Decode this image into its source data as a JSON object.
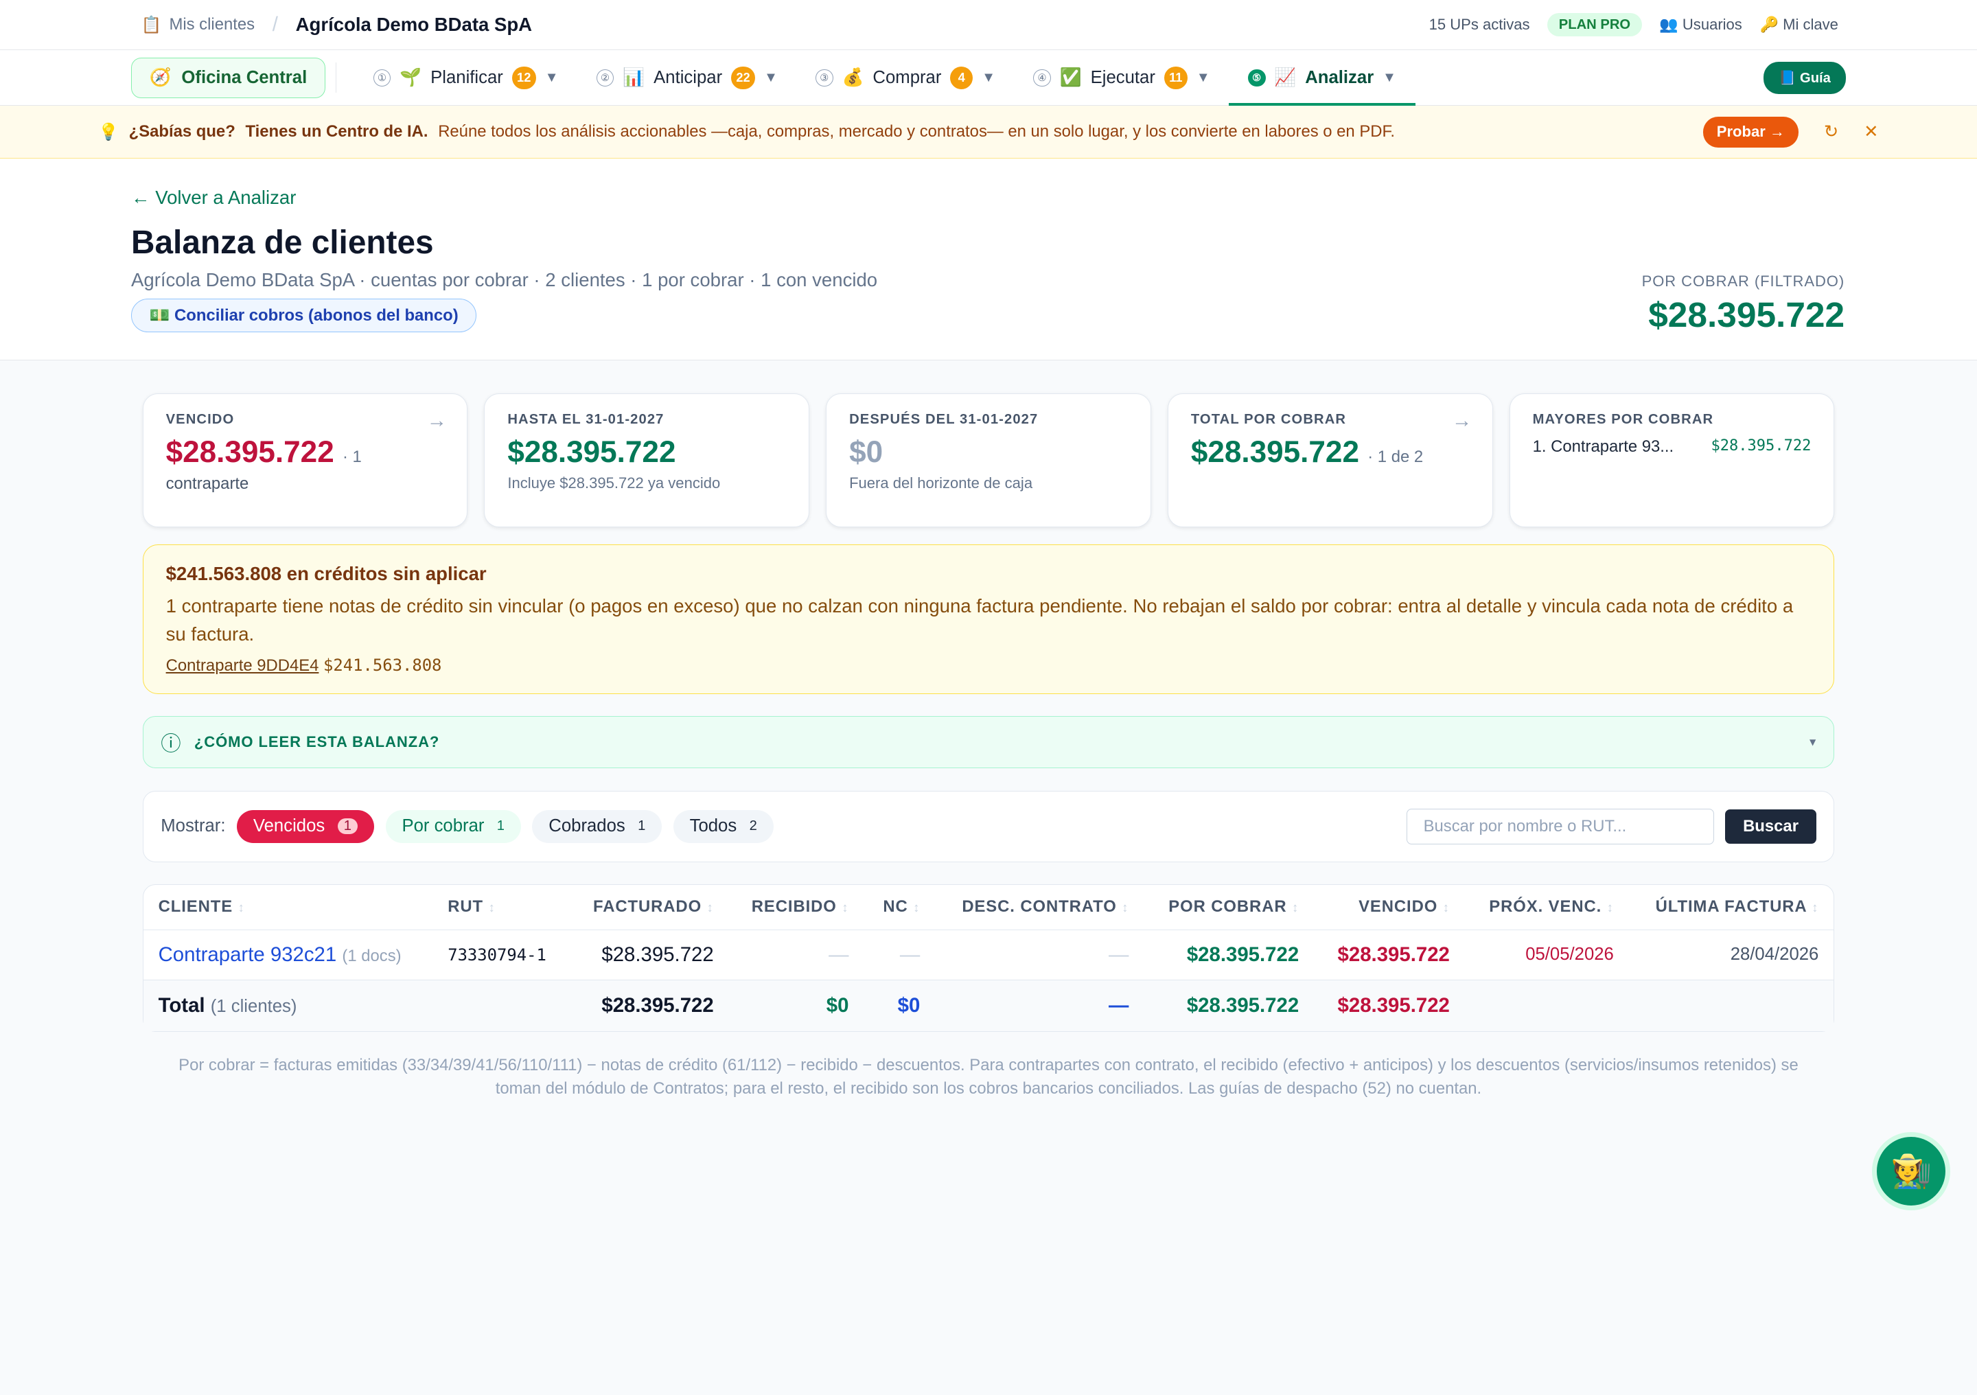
{
  "top": {
    "crumb_icon": "📋",
    "crumb": "Mis clientes",
    "org": "Agrícola Demo BData SpA",
    "ups": "15 UPs activas",
    "plan": "PLAN PRO",
    "users_icon": "👥",
    "users": "Usuarios",
    "key_icon": "🔑",
    "key": "Mi clave"
  },
  "nav": {
    "oc_icon": "🧭",
    "oc": "Oficina Central",
    "tabs": [
      {
        "num": "①",
        "icon": "🌱",
        "label": "Planificar",
        "badge": "12"
      },
      {
        "num": "②",
        "icon": "📊",
        "label": "Anticipar",
        "badge": "22"
      },
      {
        "num": "③",
        "icon": "💰",
        "label": "Comprar",
        "badge": "4"
      },
      {
        "num": "④",
        "icon": "✅",
        "label": "Ejecutar",
        "badge": "11"
      },
      {
        "num": "⑤",
        "icon": "📈",
        "label": "Analizar"
      }
    ],
    "guia": "📘 Guía"
  },
  "tip": {
    "icon": "💡",
    "q": "¿Sabías que?",
    "bold": "Tienes un Centro de IA.",
    "text": "Reúne todos los análisis accionables —caja, compras, mercado y contratos— en un solo lugar, y los convierte en labores o en PDF.",
    "btn": "Probar →",
    "refresh": "↻",
    "close": "✕"
  },
  "header": {
    "back": "← Volver a Analizar",
    "title": "Balanza de clientes",
    "sub": "Agrícola Demo BData SpA · cuentas por cobrar · 2 clientes · 1 por cobrar · 1 con vencido",
    "conc": "💵 Conciliar cobros (abonos del banco)",
    "tot_label": "POR COBRAR (FILTRADO)",
    "tot_value": "$28.395.722"
  },
  "cards": [
    {
      "label": "VENCIDO",
      "value": "$28.395.722",
      "extra": "· 1",
      "sub": "contraparte",
      "color": "#be123c",
      "arrow": "→"
    },
    {
      "label": "HASTA EL 31-01-2027",
      "value": "$28.395.722",
      "extra": "",
      "sub": "Incluye $28.395.722 ya vencido",
      "color": "#047857"
    },
    {
      "label": "DESPUÉS DEL 31-01-2027",
      "value": "$0",
      "extra": "",
      "sub": "Fuera del horizonte de caja",
      "color": "#94a3b8"
    },
    {
      "label": "TOTAL POR COBRAR",
      "value": "$28.395.722",
      "extra": "· 1 de 2",
      "sub": "",
      "color": "#047857",
      "arrow": "→"
    }
  ],
  "mayores": {
    "label": "MAYORES POR COBRAR",
    "item": "1.  Contraparte 93...",
    "amount": "$28.395.722"
  },
  "alert": {
    "title": "$241.563.808 en créditos sin aplicar",
    "text": "1 contraparte tiene notas de crédito sin vincular (o pagos en exceso) que no calzan con ninguna factura pendiente. No rebajan el saldo por cobrar: entra al detalle y vincula cada nota de crédito a su factura.",
    "link": "Contraparte 9DD4E4",
    "amount": "$241.563.808"
  },
  "howto": {
    "icon": "ⓘ",
    "label": "¿CÓMO LEER ESTA BALANZA?",
    "chev": "▾"
  },
  "filters": {
    "label": "Mostrar:",
    "chips": [
      {
        "label": "Vencidos",
        "n": "1"
      },
      {
        "label": "Por cobrar",
        "n": "1"
      },
      {
        "label": "Cobrados",
        "n": "1"
      },
      {
        "label": "Todos",
        "n": "2"
      }
    ],
    "placeholder": "Buscar por nombre o RUT...",
    "btn": "Buscar"
  },
  "table": {
    "headers": [
      "CLIENTE",
      "RUT",
      "FACTURADO",
      "RECIBIDO",
      "NC",
      "DESC. CONTRATO",
      "POR COBRAR",
      "VENCIDO",
      "PRÓX. VENC.",
      "ÚLTIMA FACTURA"
    ],
    "row": {
      "name": "Contraparte 932c21",
      "docs": "(1 docs)",
      "rut": "73330794-1",
      "facturado": "$28.395.722",
      "recibido": "—",
      "nc": "—",
      "desc": "—",
      "por_cobrar": "$28.395.722",
      "vencido": "$28.395.722",
      "prox": "05/05/2026",
      "ultima": "28/04/2026"
    },
    "total": {
      "label": "Total",
      "count": "(1 clientes)",
      "facturado": "$28.395.722",
      "recibido": "$0",
      "nc": "$0",
      "desc": "—",
      "por_cobrar": "$28.395.722",
      "vencido": "$28.395.722"
    }
  },
  "footnote": "Por cobrar = facturas emitidas (33/34/39/41/56/110/111) − notas de crédito (61/112) − recibido − descuentos. Para contrapartes con contrato, el recibido (efectivo + anticipos) y los descuentos (servicios/insumos retenidos) se toman del módulo de Contratos; para el resto, el recibido son los cobros bancarios conciliados. Las guías de despacho (52) no cuentan.",
  "fab": "🧑‍🌾"
}
